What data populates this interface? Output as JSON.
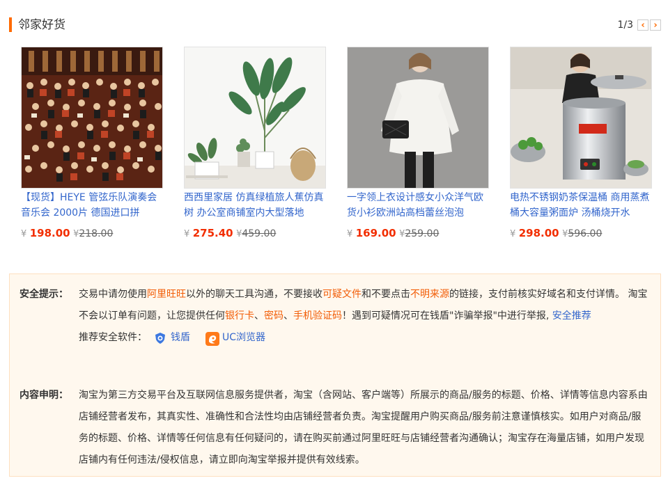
{
  "section": {
    "title": "邻家好货",
    "pager": {
      "text": "1/3",
      "prev_label": "‹",
      "next_label": "›"
    }
  },
  "products": [
    {
      "title": "【现货】HEYE 管弦乐队演奏会音乐会 2000片 德国进口拼",
      "price_symbol": "¥",
      "price": "198.00",
      "orig_symbol": "¥",
      "orig_price": "218.00"
    },
    {
      "title": "西西里家居 仿真绿植旅人蕉仿真树 办公室商铺室内大型落地",
      "price_symbol": "¥",
      "price": "275.40",
      "orig_symbol": "¥",
      "orig_price": "459.00"
    },
    {
      "title": "一字领上衣设计感女小众洋气欧货小衫欧洲站高档蕾丝泡泡",
      "price_symbol": "¥",
      "price": "169.00",
      "orig_symbol": "¥",
      "orig_price": "259.00"
    },
    {
      "title": "电热不锈钢奶茶保温桶 商用蒸煮桶大容量粥面炉 汤桶烧开水",
      "price_symbol": "¥",
      "price": "298.00",
      "orig_symbol": "¥",
      "orig_price": "596.00"
    }
  ],
  "safety": {
    "label": "安全提示：",
    "t1": "交易中请勿使用",
    "h1": "阿里旺旺",
    "t2": "以外的聊天工具沟通，不要接收",
    "h2": "可疑文件",
    "t3": "和不要点击",
    "h3": "不明来源",
    "t4": "的链接，支付前核实好域名和支付详情。 淘宝不会以订单有问题，让您提供任何",
    "h4": "银行卡",
    "t5": "、",
    "h5": "密码",
    "t6": "、",
    "h6": "手机验证码",
    "t7": "！遇到可疑情况可在钱盾\"诈骗举报\"中进行举报,",
    "link": "安全推荐",
    "software_label": "推荐安全软件：",
    "software": [
      {
        "name": "钱盾",
        "icon": "qiandun-shield-icon"
      },
      {
        "name": "UC浏览器",
        "icon": "uc-browser-icon"
      }
    ]
  },
  "disclaimer": {
    "label": "内容申明：",
    "text": "淘宝为第三方交易平台及互联网信息服务提供者，淘宝（含网站、客户端等）所展示的商品/服务的标题、价格、详情等信息内容系由店铺经营者发布，其真实性、准确性和合法性均由店铺经营者负责。淘宝提醒用户购买商品/服务前注意谨慎核实。如用户对商品/服务的标题、价格、详情等任何信息有任何疑问的，请在购买前通过阿里旺旺与店铺经营者沟通确认；淘宝存在海量店铺，如用户发现店铺内有任何违法/侵权信息，请立即向淘宝举报并提供有效线索。"
  },
  "colors": {
    "accent": "#ff6a00",
    "price": "#f22e00",
    "link": "#3366cc",
    "highlight": "#f25c05",
    "notice_bg": "#fff8ee"
  }
}
